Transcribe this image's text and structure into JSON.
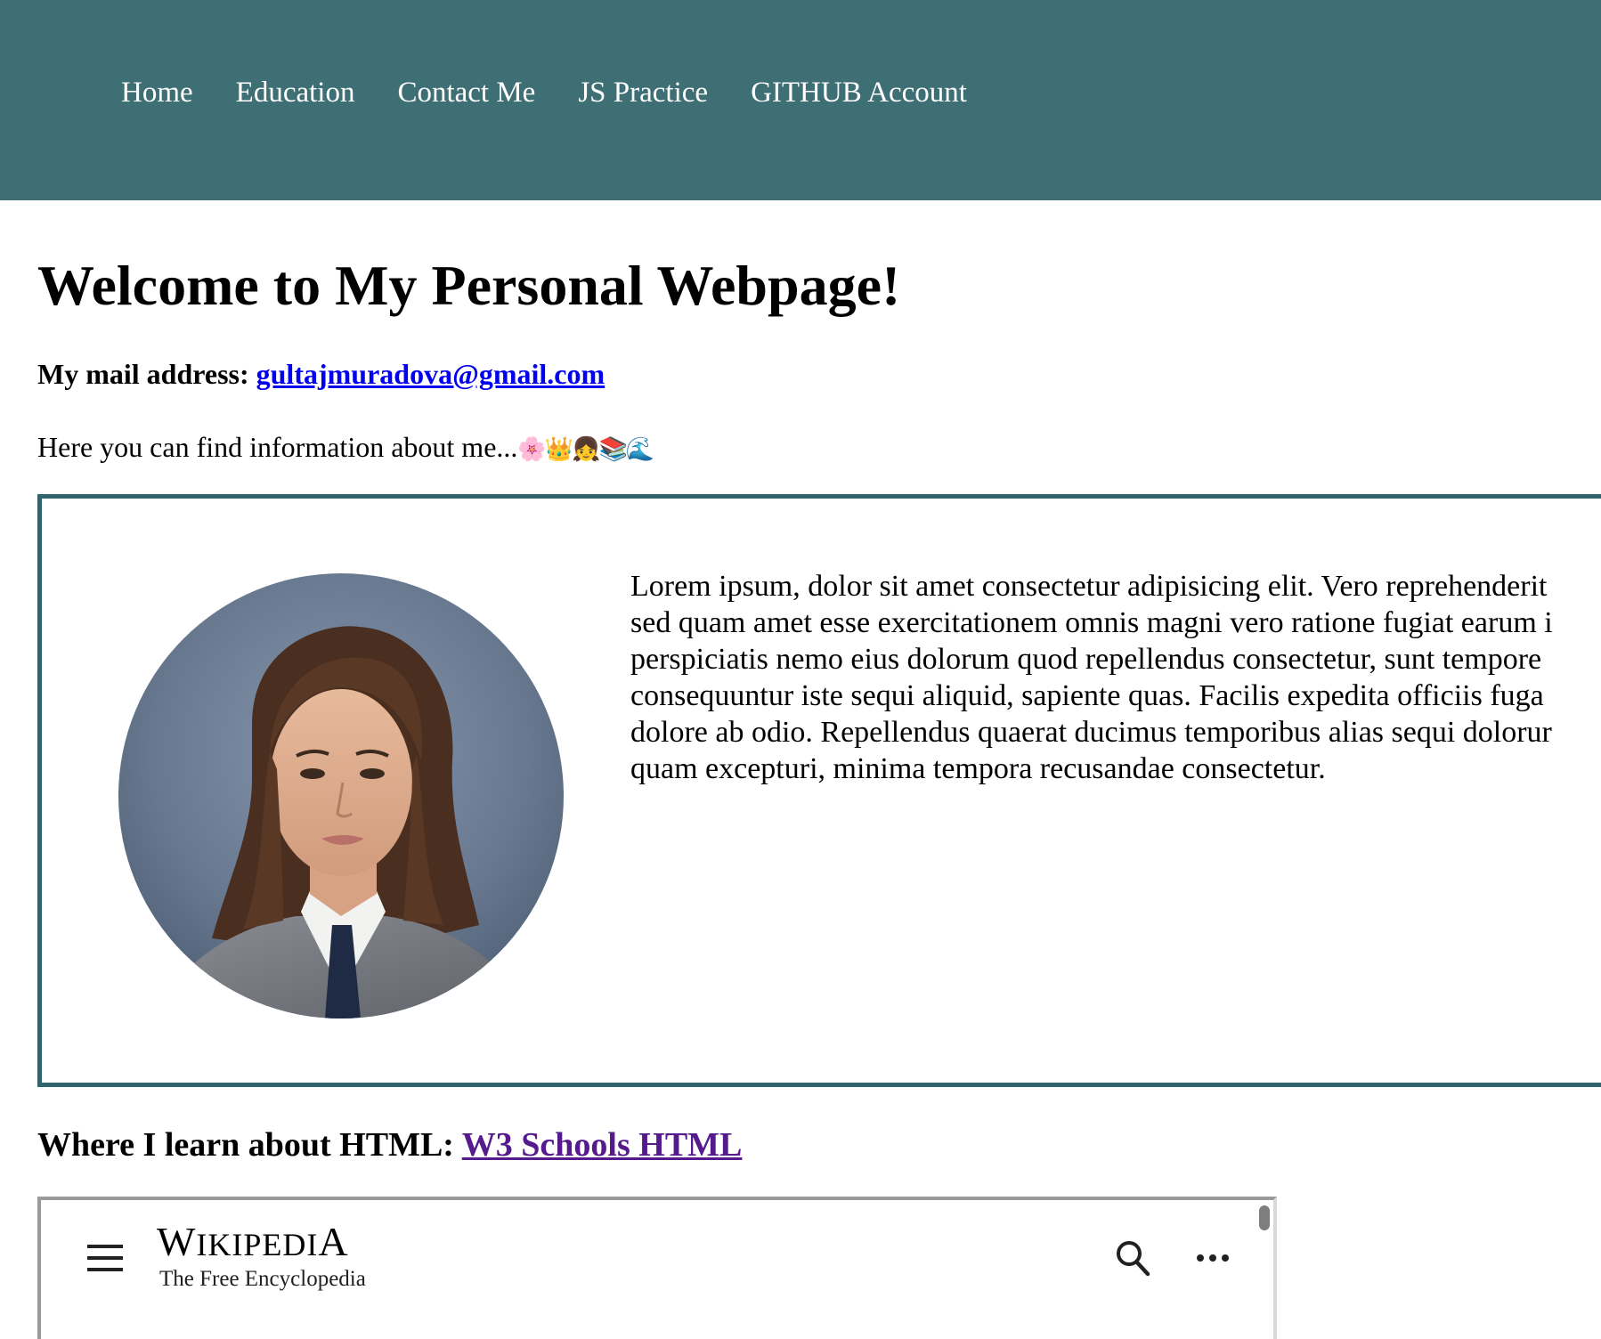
{
  "nav": {
    "items": [
      "Home",
      "Education",
      "Contact Me",
      "JS Practice",
      "GITHUB Account"
    ]
  },
  "main": {
    "title": "Welcome to My Personal Webpage!",
    "mail_label": "My mail address:",
    "mail_link": "gultajmuradova@gmail.com",
    "intro_text": "Here you can find information about me...",
    "intro_emojis": "🌸👑👧📚🌊"
  },
  "about": {
    "lines": [
      "Lorem ipsum, dolor sit amet consectetur adipisicing elit. Vero reprehenderit",
      "sed quam amet esse exercitationem omnis magni vero ratione fugiat earum i",
      "perspiciatis nemo eius dolorum quod repellendus consectetur, sunt tempore",
      "consequuntur iste sequi aliquid, sapiente quas. Facilis expedita officiis fuga",
      "dolore ab odio. Repellendus quaerat ducimus temporibus alias sequi dolorur",
      "quam excepturi, minima tempora recusandae consectetur."
    ]
  },
  "learn": {
    "label": "Where I learn about HTML:",
    "link": "W3 Schools HTML"
  },
  "embed": {
    "logo_first": "W",
    "logo_mid": "IKIPEDI",
    "logo_last": "A",
    "tagline": "The Free Encyclopedia"
  },
  "colors": {
    "nav_bg": "#3e6f74",
    "box_border": "#33636a",
    "link": "#0000ee",
    "visited_link": "#551a8b"
  },
  "icons": [
    "menu-icon",
    "search-icon",
    "more-icon"
  ]
}
